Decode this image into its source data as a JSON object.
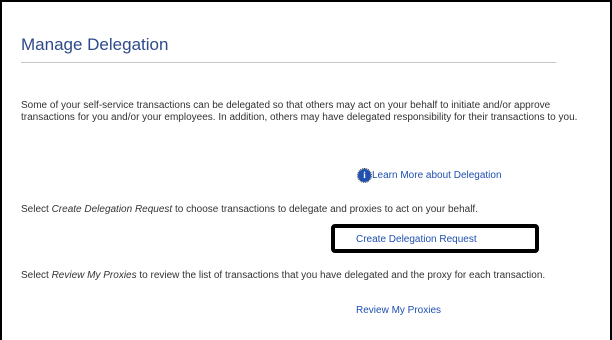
{
  "page": {
    "title": "Manage Delegation",
    "intro": "Some of your self-service transactions can be delegated so that others may act on your behalf to initiate and/or approve transactions for you and/or your employees. In addition, others may have delegated responsibility for their transactions to you.",
    "learn_more_label": "Learn More about Delegation",
    "info_icon_glyph": "i",
    "create_prefix": "Select ",
    "create_term": "Create Delegation Request",
    "create_suffix": " to choose transactions to delegate and proxies to act on your behalf.",
    "create_link_label": "Create Delegation Request",
    "review_prefix": "Select ",
    "review_term": "Review My Proxies",
    "review_suffix": " to review the list of transactions that you have delegated and the proxy for each transaction.",
    "review_link_label": "Review My Proxies"
  },
  "colors": {
    "title": "#2d4a8a",
    "link": "#1f4fb0",
    "highlight_box": "#000000"
  }
}
